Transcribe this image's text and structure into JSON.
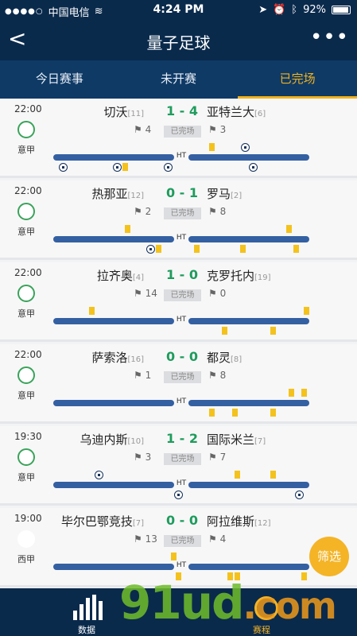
{
  "status_bar": {
    "carrier": "中国电信",
    "time": "4:24 PM",
    "battery": "92%"
  },
  "nav": {
    "back": "<",
    "title": "量子足球",
    "more": "•••"
  },
  "tabs": [
    {
      "label": "今日赛事",
      "active": false
    },
    {
      "label": "未开赛",
      "active": false
    },
    {
      "label": "已完场",
      "active": true
    }
  ],
  "matches": [
    {
      "time": "22:00",
      "league": "意甲",
      "home": "切沃",
      "home_rank": "[11]",
      "score": "1 - 4",
      "away": "亚特兰大",
      "away_rank": "[6]",
      "status": "已完场",
      "home_corners": "4",
      "away_corners": "3",
      "events": [
        {
          "t": "card",
          "side": "top",
          "p": 0.62
        },
        {
          "t": "goal",
          "side": "top",
          "p": 0.75
        },
        {
          "t": "goal",
          "side": "bottom",
          "p": 0.04
        },
        {
          "t": "goal",
          "side": "bottom",
          "p": 0.25
        },
        {
          "t": "card",
          "side": "bottom",
          "p": 0.28
        },
        {
          "t": "goal",
          "side": "bottom",
          "p": 0.45
        },
        {
          "t": "goal",
          "side": "bottom",
          "p": 0.78
        }
      ]
    },
    {
      "time": "22:00",
      "league": "意甲",
      "home": "热那亚",
      "home_rank": "[12]",
      "score": "0 - 1",
      "away": "罗马",
      "away_rank": "[2]",
      "status": "已完场",
      "home_corners": "2",
      "away_corners": "8",
      "events": [
        {
          "t": "card",
          "side": "top",
          "p": 0.29
        },
        {
          "t": "card",
          "side": "top",
          "p": 0.92
        },
        {
          "t": "goal",
          "side": "bottom",
          "p": 0.38,
          "red": true
        },
        {
          "t": "card",
          "side": "bottom",
          "p": 0.41
        },
        {
          "t": "card",
          "side": "bottom",
          "p": 0.56
        },
        {
          "t": "card",
          "side": "bottom",
          "p": 0.74
        },
        {
          "t": "card",
          "side": "bottom",
          "p": 0.95
        }
      ]
    },
    {
      "time": "22:00",
      "league": "意甲",
      "home": "拉齐奥",
      "home_rank": "[4]",
      "score": "1 - 0",
      "away": "克罗托内",
      "away_rank": "[19]",
      "status": "已完场",
      "home_corners": "14",
      "away_corners": "0",
      "events": [
        {
          "t": "card",
          "side": "top",
          "p": 0.15
        },
        {
          "t": "card",
          "side": "top",
          "p": 0.99
        },
        {
          "t": "card",
          "side": "bottom",
          "p": 0.67
        },
        {
          "t": "card",
          "side": "bottom",
          "p": 0.86
        }
      ]
    },
    {
      "time": "22:00",
      "league": "意甲",
      "home": "萨索洛",
      "home_rank": "[16]",
      "score": "0 - 0",
      "away": "都灵",
      "away_rank": "[8]",
      "status": "已完场",
      "home_corners": "1",
      "away_corners": "8",
      "events": [
        {
          "t": "card",
          "side": "top",
          "p": 0.93
        },
        {
          "t": "card",
          "side": "top",
          "p": 0.98
        },
        {
          "t": "card",
          "side": "bottom",
          "p": 0.62
        },
        {
          "t": "card",
          "side": "bottom",
          "p": 0.71
        },
        {
          "t": "card",
          "side": "bottom",
          "p": 0.86
        }
      ]
    },
    {
      "time": "19:30",
      "league": "意甲",
      "home": "乌迪内斯",
      "home_rank": "[10]",
      "score": "1 - 2",
      "away": "国际米兰",
      "away_rank": "[7]",
      "status": "已完场",
      "home_corners": "3",
      "away_corners": "7",
      "events": [
        {
          "t": "goal",
          "side": "top",
          "p": 0.18
        },
        {
          "t": "card",
          "side": "top",
          "p": 0.72
        },
        {
          "t": "card",
          "side": "top",
          "p": 0.86
        },
        {
          "t": "goal",
          "side": "bottom",
          "p": 0.49
        },
        {
          "t": "goal",
          "side": "bottom",
          "p": 0.96
        }
      ]
    },
    {
      "time": "19:00",
      "league": "西甲",
      "home": "毕尔巴鄂竞技",
      "home_rank": "[7]",
      "score": "0 - 0",
      "away": "阿拉维斯",
      "away_rank": "[12]",
      "status": "已完场",
      "home_corners": "13",
      "away_corners": "4",
      "events": [
        {
          "t": "card",
          "side": "top",
          "p": 0.47
        },
        {
          "t": "card",
          "side": "bottom",
          "p": 0.49
        },
        {
          "t": "card",
          "side": "bottom",
          "p": 0.69
        },
        {
          "t": "card",
          "side": "bottom",
          "p": 0.72
        },
        {
          "t": "card",
          "side": "bottom",
          "p": 0.98
        }
      ]
    }
  ],
  "filter_button": "筛选",
  "bottom_nav": {
    "data_label": "数据",
    "schedule_label": "赛程"
  },
  "watermark": {
    "text": "91ud",
    "tld": ".com"
  },
  "colors": {
    "navy": "#0a2a4c",
    "accent": "#f3b21b",
    "score_green": "#1e9c5c",
    "timeline": "#3460a2",
    "card": "#f4c21c"
  }
}
